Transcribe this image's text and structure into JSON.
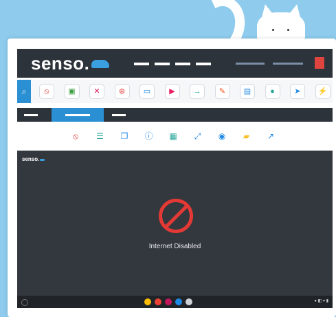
{
  "brand": {
    "name": "senso.",
    "accent": "#3aa0e0"
  },
  "toolbar": {
    "tools": [
      {
        "icon": "block-icon",
        "glyph": "⦸",
        "color": "#e53935"
      },
      {
        "icon": "photo-icon",
        "glyph": "▣",
        "color": "#43a047"
      },
      {
        "icon": "mute-icon",
        "glyph": "✕",
        "color": "#d81b60"
      },
      {
        "icon": "globe-icon",
        "glyph": "⊕",
        "color": "#e53935"
      },
      {
        "icon": "cast-icon",
        "glyph": "▭",
        "color": "#1e88e5"
      },
      {
        "icon": "video-icon",
        "glyph": "▶",
        "color": "#e91e63"
      },
      {
        "icon": "login-icon",
        "glyph": "→",
        "color": "#26a69a"
      },
      {
        "icon": "edit-icon",
        "glyph": "✎",
        "color": "#f4511e"
      },
      {
        "icon": "document-icon",
        "glyph": "▤",
        "color": "#1e88e5"
      },
      {
        "icon": "chat-icon",
        "glyph": "●",
        "color": "#26a69a"
      },
      {
        "icon": "send-icon",
        "glyph": "➤",
        "color": "#1e88e5"
      },
      {
        "icon": "usb-icon",
        "glyph": "⚡",
        "color": "#e53935"
      }
    ]
  },
  "subtools": [
    {
      "icon": "block-small-icon",
      "glyph": "⦸",
      "color": "#e53935"
    },
    {
      "icon": "list-icon",
      "glyph": "☰",
      "color": "#26a69a"
    },
    {
      "icon": "copy-icon",
      "glyph": "❐",
      "color": "#1e88e5"
    },
    {
      "icon": "info-icon",
      "glyph": "ⓘ",
      "color": "#1e88e5"
    },
    {
      "icon": "monitor-icon",
      "glyph": "▦",
      "color": "#26a69a"
    },
    {
      "icon": "fullscreen-icon",
      "glyph": "⤢",
      "color": "#1e88e5"
    },
    {
      "icon": "camera-icon",
      "glyph": "◉",
      "color": "#1e88e5"
    },
    {
      "icon": "folder-icon",
      "glyph": "▰",
      "color": "#fbc02d"
    },
    {
      "icon": "share-icon",
      "glyph": "↗",
      "color": "#1e88e5"
    }
  ],
  "screen": {
    "logo": "senso.",
    "message": "Internet Disabled",
    "shelf_apps": [
      {
        "icon": "chrome-icon",
        "color": "#fbbc05"
      },
      {
        "icon": "app-red-icon",
        "color": "#ea4335"
      },
      {
        "icon": "app-magenta-icon",
        "color": "#c2185b"
      },
      {
        "icon": "app-blue-icon",
        "color": "#1e88e5"
      },
      {
        "icon": "app-gray-icon",
        "color": "#cfd3d8"
      }
    ]
  }
}
